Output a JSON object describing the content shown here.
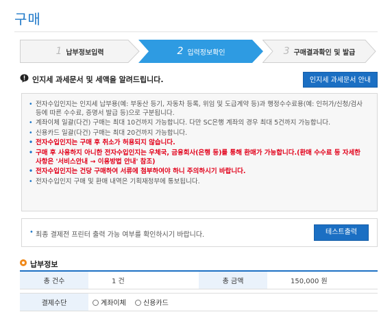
{
  "page": {
    "title": "구매"
  },
  "steps": [
    {
      "number": "1",
      "label": "납부정보입력",
      "state": "inactive"
    },
    {
      "number": "2",
      "label": "입력정보확인",
      "state": "active"
    },
    {
      "number": "3",
      "label": "구매결과확인 및 발급",
      "state": "inactive"
    }
  ],
  "notice": {
    "text": "인지세 과세문서 및 세액을 알려드립니다.",
    "guide_button": "인지세 과세문서 안내"
  },
  "info_items": [
    {
      "text": "전자수입인지는 인지세 납부용(예: 부동산 등기, 자동차 등록, 위임 및 도급계약 등)과 행정수수료용(예: 인허가/신청/검사 등에 따른 수수료, 증명서 발급 등)으로 구분됩니다.",
      "emphasis": false
    },
    {
      "text": "계좌이체 일괄(다건) 구매는 최대 10건까지 가능합니다. 다만 SC은행 계좌의 경우 최대 5건까지 가능합니다.",
      "emphasis": false
    },
    {
      "text": "신용카드 일괄(다건) 구매는 최대 20건까지 가능합니다.",
      "emphasis": false
    },
    {
      "text": "전자수입인지는 구매 후 취소가 허용되지 않습니다.",
      "emphasis": true
    },
    {
      "text": "구매 후 사용하지 아니한 전자수입인지는 우체국, 금융회사(은행 등)를 통해 환매가 가능합니다.(환매 수수료 등 자세한 사항은 '서비스안내 → 이용방법 안내' 참조)",
      "emphasis": true
    },
    {
      "text": "전자수입인지는 건당 구매하여 서류에 첨부하여야 하니 주의하시기 바랍니다.",
      "emphasis": true
    },
    {
      "text": "전자수입인지 구매 및 환매 내역은 기획재정부에 통보됩니다.",
      "emphasis": false
    }
  ],
  "print_check": {
    "text": "최종 결제전 프린터 출력 가능 여부를 확인하시기 바랍니다.",
    "button": "테스트출력"
  },
  "payment_info": {
    "section_title": "납부정보",
    "count_label": "총 건수",
    "count_value": "1 건",
    "amount_label": "총 금액",
    "amount_value": "150,000 원",
    "method_label": "결제수단",
    "methods": [
      "계좌이체",
      "신용카드"
    ]
  },
  "colors": {
    "accent": "#1b6fc3",
    "title": "#1e78c8",
    "warning": "#e2001a",
    "step_inactive_bg": "#f4f4f4",
    "step_active_bg": "#2e9be2",
    "section_marker": "#f08a1c"
  },
  "icons": {
    "notice": "exclamation-bubble-icon",
    "section": "ring-bullet-icon"
  }
}
